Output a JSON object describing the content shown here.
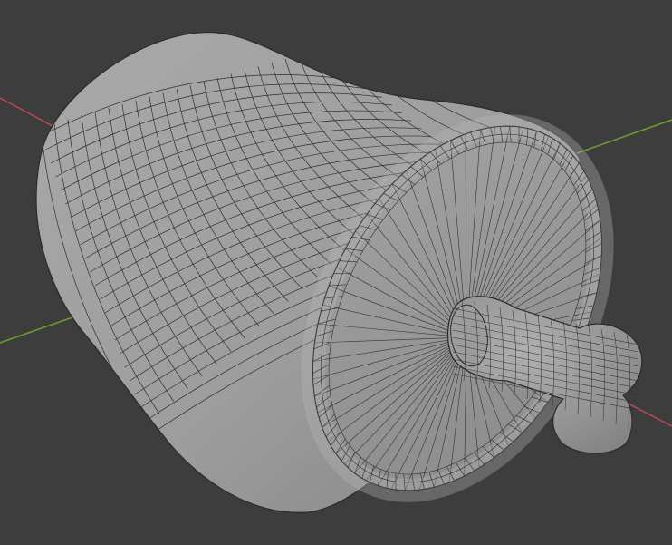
{
  "viewport": {
    "background_color": "#3d3d3d",
    "grid_x_axis_color": "#b5474f",
    "grid_y_axis_color": "#6f9a32",
    "mesh_face_color": "#9a9a9a",
    "mesh_wire_color": "#2b2b2b",
    "show_wireframe": true,
    "object_type": "mesh"
  }
}
